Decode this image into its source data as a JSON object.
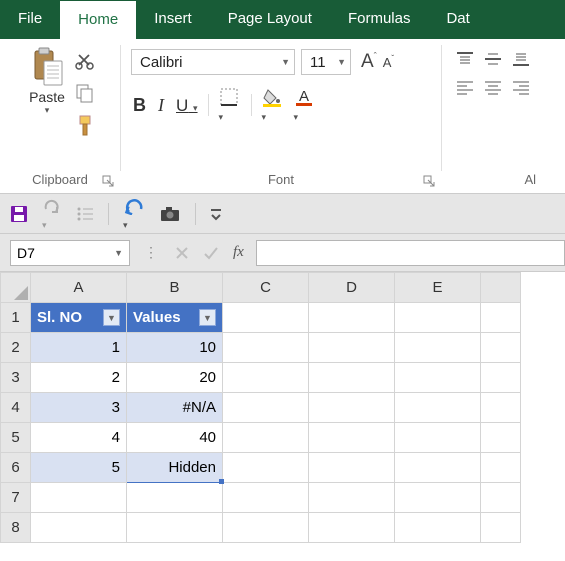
{
  "tabs": {
    "file": "File",
    "home": "Home",
    "insert": "Insert",
    "page_layout": "Page Layout",
    "formulas": "Formulas",
    "data": "Dat"
  },
  "ribbon": {
    "clipboard": {
      "paste": "Paste",
      "label": "Clipboard"
    },
    "font": {
      "name": "Calibri",
      "size": "11",
      "bold": "B",
      "italic": "I",
      "underline": "U",
      "label": "Font"
    },
    "align": {
      "label": "Al"
    }
  },
  "namebox": {
    "ref": "D7",
    "fx": "fx"
  },
  "columns": [
    "A",
    "B",
    "C",
    "D",
    "E"
  ],
  "rows": [
    "1",
    "2",
    "3",
    "4",
    "5",
    "6",
    "7",
    "8"
  ],
  "table": {
    "headers": {
      "a": "Sl. NO",
      "b": "Values"
    },
    "data": [
      {
        "a": "1",
        "b": "10"
      },
      {
        "a": "2",
        "b": "20"
      },
      {
        "a": "3",
        "b": "#N/A"
      },
      {
        "a": "4",
        "b": "40"
      },
      {
        "a": "5",
        "b": "Hidden"
      }
    ]
  }
}
